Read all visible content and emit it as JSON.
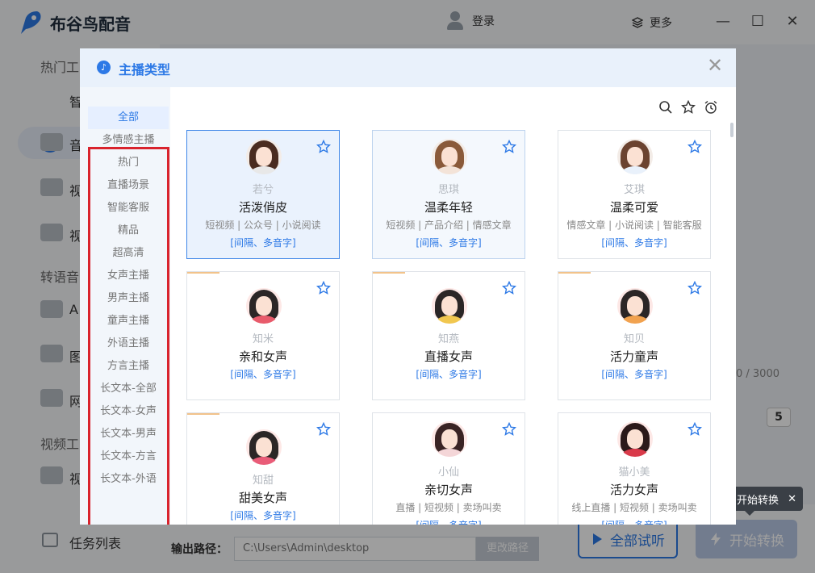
{
  "app": {
    "title": "布谷鸟配音",
    "login": "登录",
    "more": "更多",
    "window_controls": {
      "minimize": "—",
      "maximize": "☐",
      "close": "✕"
    }
  },
  "sidebar": {
    "sections": [
      "热门工",
      "转语音",
      "视频工"
    ],
    "items": [
      "智",
      "音",
      "视",
      "视",
      "A",
      "图",
      "网",
      "视"
    ],
    "task_list": "任务列表"
  },
  "bottom": {
    "output_label": "输出路径：",
    "output_path": "C:\\Users\\Admin\\desktop",
    "change_path": "更改路径",
    "trial_all": "全部试听",
    "start": "开始转换",
    "tooltip": "开始转换",
    "counter": "0 / 3000",
    "speed": "5"
  },
  "dialog": {
    "title": "主播类型",
    "close": "✕",
    "categories": [
      "全部",
      "多情感主播",
      "热门",
      "直播场景",
      "智能客服",
      "精品",
      "超高清",
      "女声主播",
      "男声主播",
      "童声主播",
      "外语主播",
      "方言主播",
      "长文本-全部",
      "长文本-女声",
      "长文本-男声",
      "长文本-方言",
      "长文本-外语"
    ],
    "active_category": "全部",
    "tools": {
      "search": "search-icon",
      "favorite": "star-icon",
      "history": "alarm-clock-icon"
    },
    "cards": [
      {
        "name": "若兮",
        "type": "活泼俏皮",
        "tags": "短视频 | 公众号 | 小说阅读",
        "features": "[间隔、多音字]",
        "hair": "#4a2c20",
        "outfit": "#e8e8e8"
      },
      {
        "name": "思琪",
        "type": "温柔年轻",
        "tags": "短视频 | 产品介绍 | 情感文章",
        "features": "[间隔、多音字]",
        "hair": "#8a5a3a",
        "outfit": "#f3e3d8"
      },
      {
        "name": "艾琪",
        "type": "温柔可爱",
        "tags": "情感文章 | 小说阅读 | 智能客服",
        "features": "[间隔、多音字]",
        "hair": "#6b4330",
        "outfit": "#e9f1fb"
      },
      {
        "name": "知米",
        "type": "亲和女声",
        "tags": "",
        "features": "[间隔、多音字]",
        "hair": "#2b2626",
        "outfit": "#e85b6b"
      },
      {
        "name": "知燕",
        "type": "直播女声",
        "tags": "",
        "features": "[间隔、多音字]",
        "hair": "#2b2626",
        "outfit": "#f1c74f"
      },
      {
        "name": "知贝",
        "type": "活力童声",
        "tags": "",
        "features": "[间隔、多音字]",
        "hair": "#2b2626",
        "outfit": "#f1a24f"
      },
      {
        "name": "知甜",
        "type": "甜美女声",
        "tags": "",
        "features": "[间隔、多音字]",
        "hair": "#2b2626",
        "outfit": "#e95c78"
      },
      {
        "name": "小仙",
        "type": "亲切女声",
        "tags": "直播 | 短视频 | 卖场叫卖",
        "features": "[间隔、多音字]",
        "hair": "#3a2424",
        "outfit": "#f4d6d8"
      },
      {
        "name": "猫小美",
        "type": "活力女声",
        "tags": "线上直播 | 短视频 | 卖场叫卖",
        "features": "[间隔、多音字]",
        "hair": "#2b1a1a",
        "outfit": "#d93a4a"
      }
    ]
  }
}
